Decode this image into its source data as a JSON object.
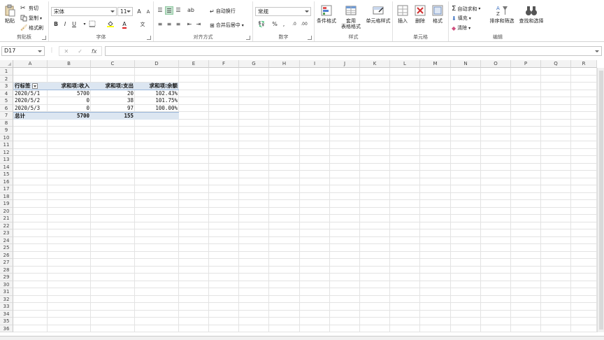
{
  "ribbon": {
    "clipboard": {
      "paste": "粘贴",
      "cut": "剪切",
      "copy": "复制",
      "format_painter": "格式刷",
      "label": "剪贴板"
    },
    "font": {
      "name": "宋体",
      "size": "11",
      "bold": "B",
      "italic": "I",
      "underline": "U",
      "grow": "A",
      "shrink": "A",
      "label": "字体"
    },
    "alignment": {
      "wrap": "自动换行",
      "merge": "合并后居中",
      "label": "对齐方式"
    },
    "number": {
      "format": "常规",
      "percent": "%",
      "comma": ",",
      "label": "数字"
    },
    "styles": {
      "conditional": "条件格式",
      "table_line1": "套用",
      "table_line2": "表格格式",
      "cell_styles": "单元格样式",
      "label": "样式"
    },
    "cells": {
      "insert": "插入",
      "delete": "删除",
      "format": "格式",
      "label": "单元格"
    },
    "editing": {
      "autosum": "自动求和",
      "fill": "填充",
      "clear": "清除",
      "sort": "排序和筛选",
      "find": "查找和选择",
      "label": "编辑"
    }
  },
  "formula_bar": {
    "name_box": "D17",
    "fx": "fx",
    "cancel": "✕",
    "enter": "✓",
    "value": ""
  },
  "columns": [
    "A",
    "B",
    "C",
    "D",
    "E",
    "F",
    "G",
    "H",
    "I",
    "J",
    "K",
    "L",
    "M",
    "N",
    "O",
    "P",
    "Q",
    "R"
  ],
  "rows": [
    "1",
    "2",
    "3",
    "4",
    "5",
    "6",
    "7",
    "8",
    "9",
    "10",
    "11",
    "12",
    "13",
    "14",
    "15",
    "16",
    "17",
    "18",
    "19",
    "20",
    "21",
    "22",
    "23",
    "24",
    "25",
    "26",
    "27",
    "28",
    "29",
    "30",
    "31",
    "32",
    "33",
    "34",
    "35",
    "36"
  ],
  "pivot": {
    "headers": [
      "行标签",
      "求和项:收入",
      "求和项:支出",
      "求和项:余额"
    ],
    "rows": [
      [
        "2020/5/1",
        "5700",
        "20",
        "102.43%"
      ],
      [
        "2020/5/2",
        "0",
        "38",
        "101.75%"
      ],
      [
        "2020/5/3",
        "0",
        "97",
        "100.00%"
      ]
    ],
    "total": [
      "总计",
      "5700",
      "155",
      ""
    ]
  }
}
